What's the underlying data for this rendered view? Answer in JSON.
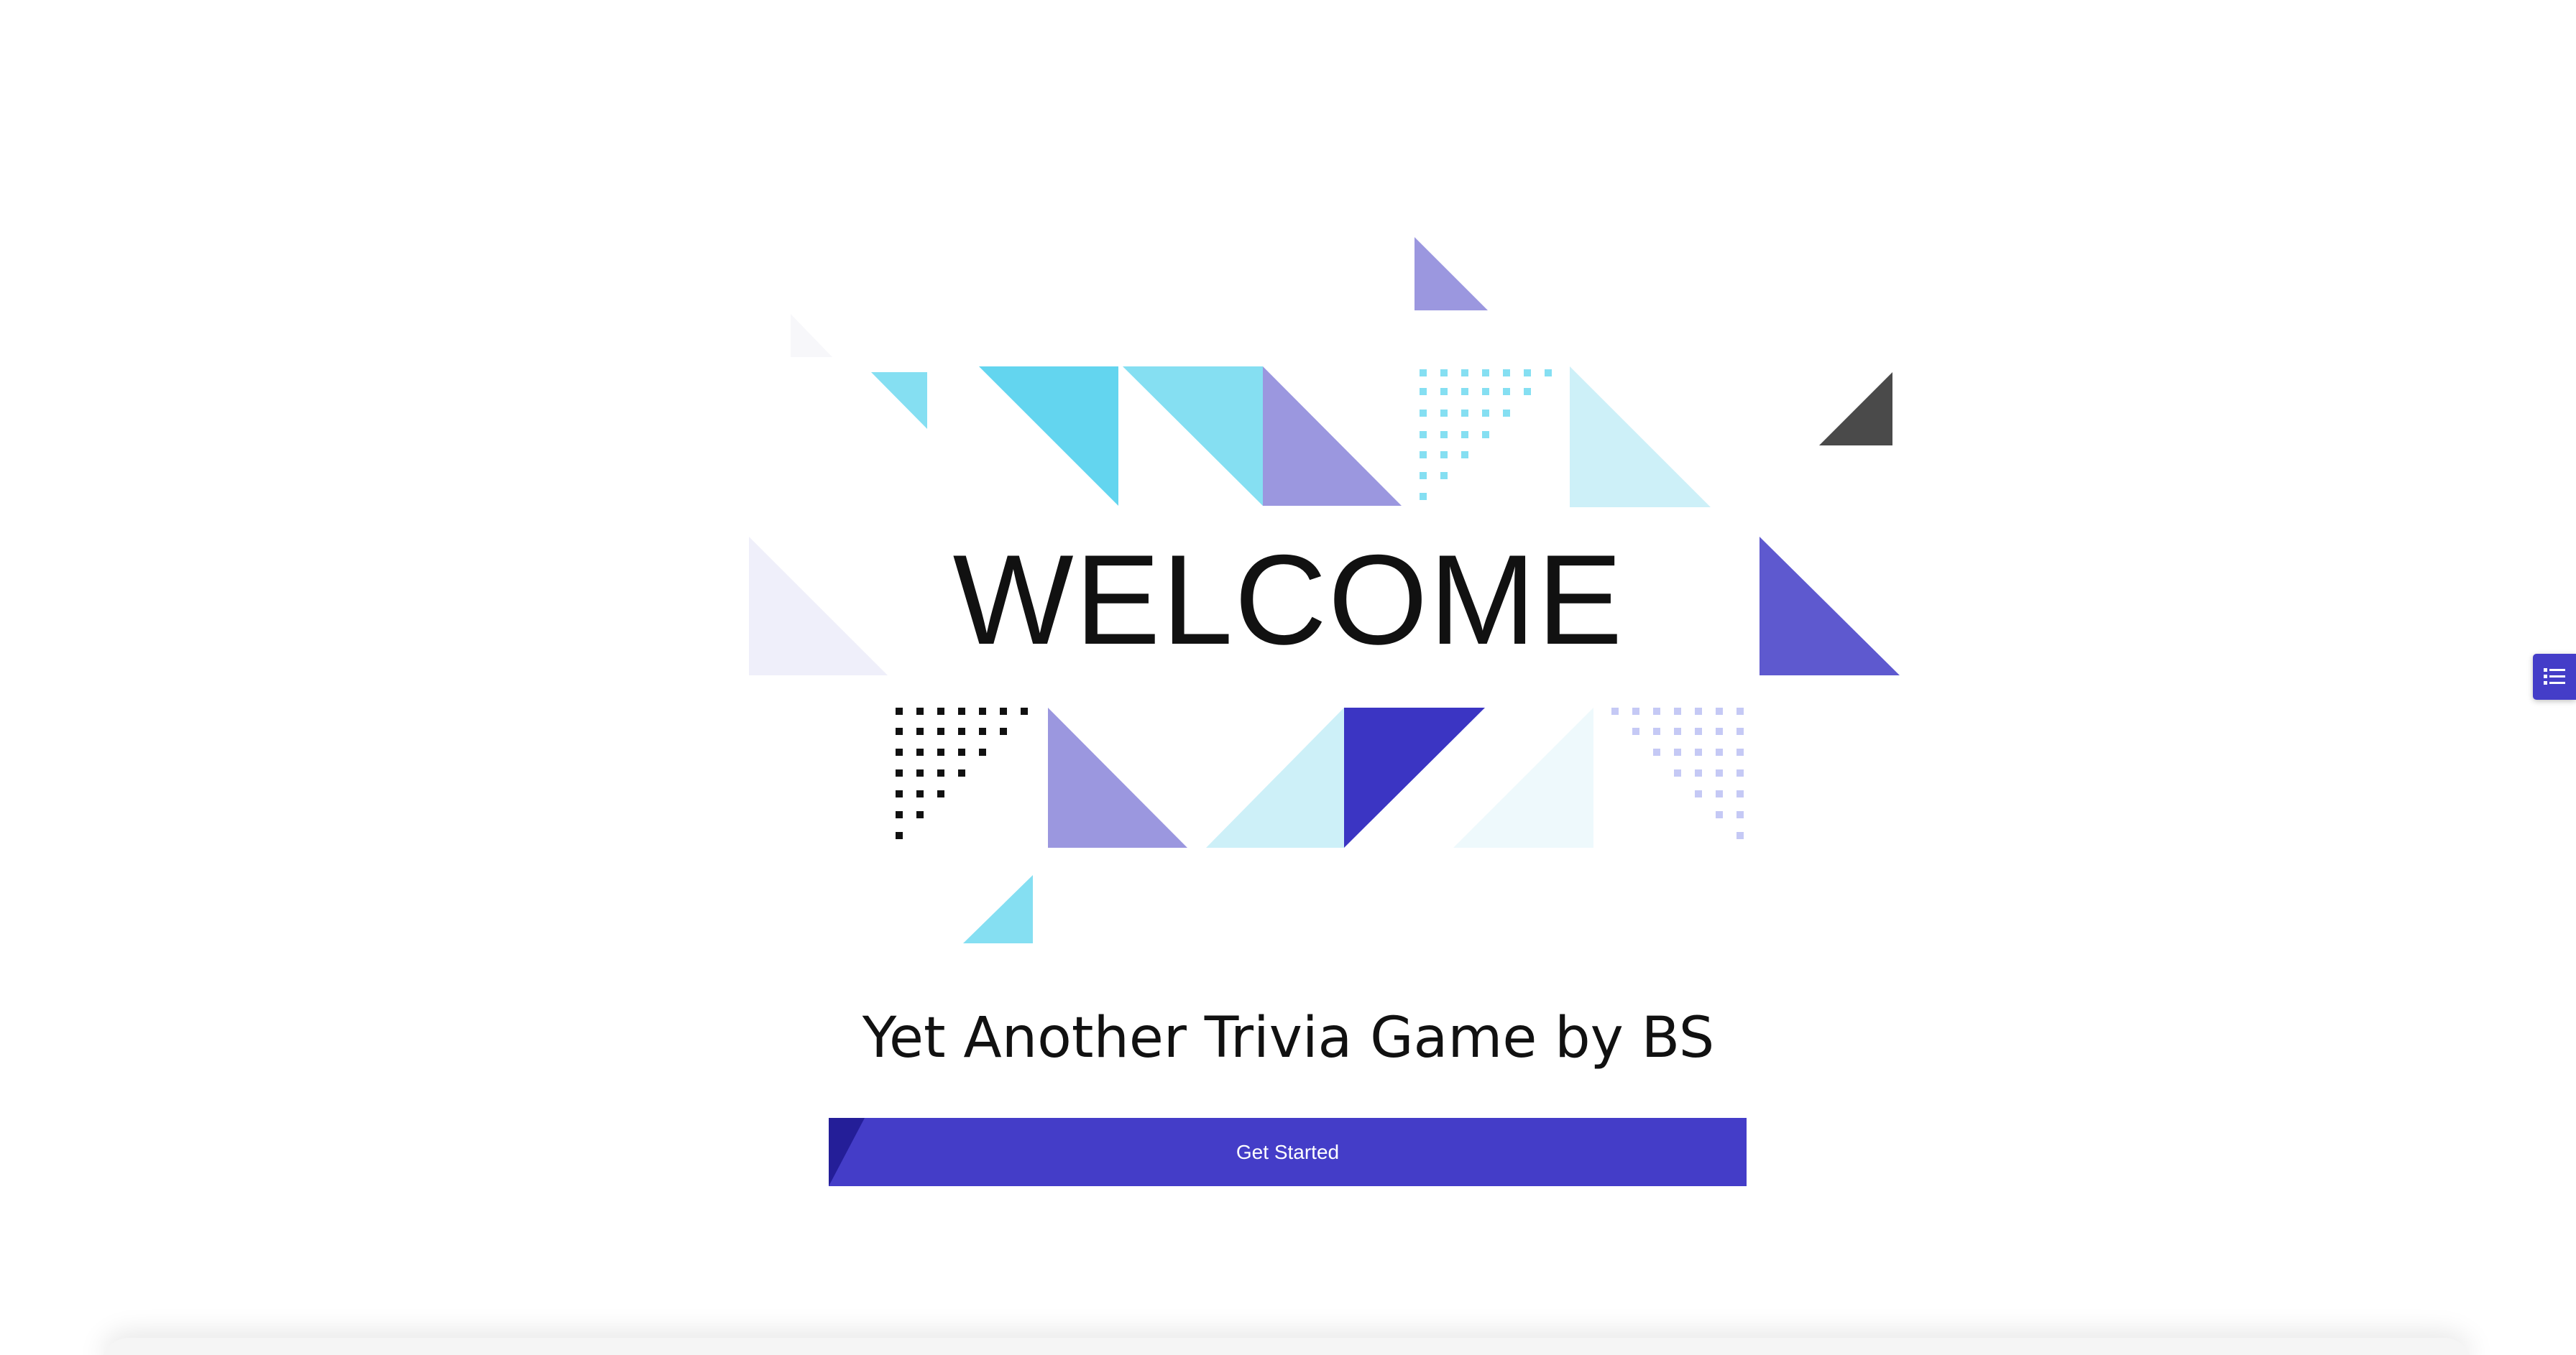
{
  "hero": {
    "title": "WELCOME",
    "subtitle": "Yet Another Trivia Game by BS",
    "cta_label": "Get Started"
  },
  "side_tab": {
    "icon": "list-icon"
  },
  "colors": {
    "primary": "#443dc8",
    "primary_dark": "#241e98",
    "cyan": "#63d5ef",
    "light_cyan": "#85dff2",
    "pale_cyan": "#cdf0f8",
    "lavender": "#9b97df",
    "indigo": "#5e59cf",
    "deep_indigo": "#3b35c3",
    "charcoal": "#4a4a4a",
    "text": "#111111"
  }
}
